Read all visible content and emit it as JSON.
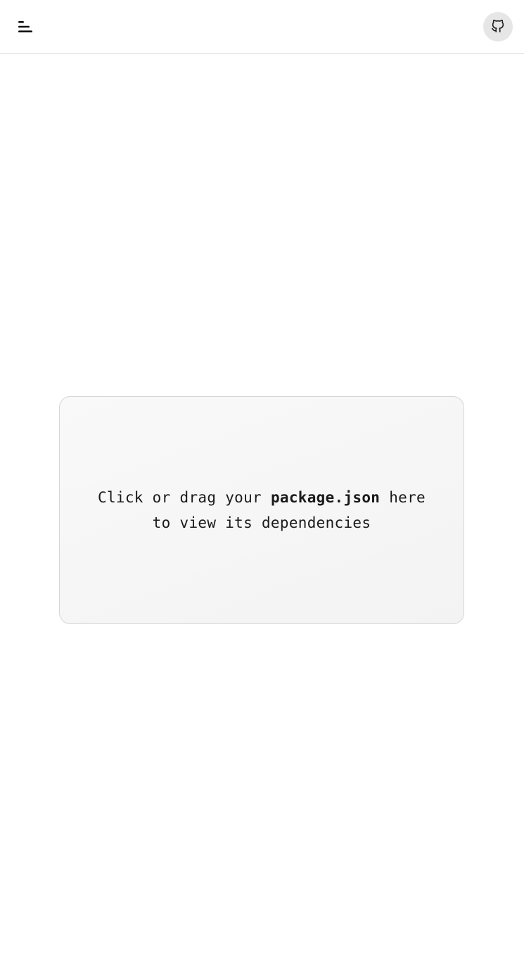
{
  "header": {
    "menu_icon": "menu-icon",
    "github_icon": "github-icon"
  },
  "dropzone": {
    "line1_before": "Click or drag your ",
    "filename": "package.json",
    "line1_after": " here",
    "line2": "to view its dependencies"
  },
  "colors": {
    "header_border": "#d9d9d9",
    "github_button_bg": "#e6e6e6",
    "dropzone_bg": "#f6f6f6",
    "dropzone_border": "#d6d6d6",
    "text": "#1a1a1a"
  }
}
